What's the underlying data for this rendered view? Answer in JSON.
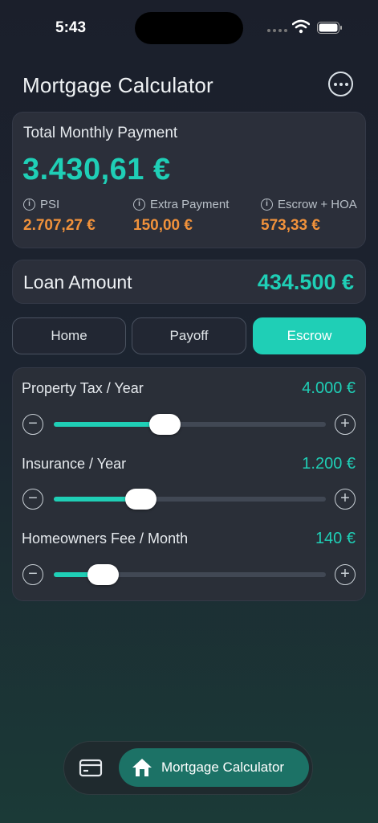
{
  "status_bar": {
    "time": "5:43"
  },
  "header": {
    "title": "Mortgage Calculator"
  },
  "summary": {
    "label": "Total Monthly Payment",
    "total": "3.430,61 €",
    "breakdown": [
      {
        "label": "PSI",
        "value": "2.707,27 €"
      },
      {
        "label": "Extra Payment",
        "value": "150,00 €"
      },
      {
        "label": "Escrow + HOA",
        "value": "573,33 €"
      }
    ]
  },
  "loan": {
    "label": "Loan Amount",
    "value": "434.500 €"
  },
  "segments": {
    "home": "Home",
    "payoff": "Payoff",
    "escrow": "Escrow",
    "selected": "Escrow"
  },
  "sliders": [
    {
      "label": "Property Tax / Year",
      "value": "4.000 €",
      "fraction": 0.41
    },
    {
      "label": "Insurance / Year",
      "value": "1.200 €",
      "fraction": 0.32
    },
    {
      "label": "Homeowners Fee / Month",
      "value": "140 €",
      "fraction": 0.18
    }
  ],
  "tabbar": {
    "active_label": "Mortgage Calculator"
  },
  "colors": {
    "accent": "#1fcfb6",
    "orange": "#f1923b",
    "tab_active": "#1c7266"
  },
  "icons": [
    "card-icon",
    "home-icon",
    "more-icon",
    "info-icon",
    "minus-icon",
    "plus-icon",
    "wifi-icon",
    "battery-icon"
  ]
}
